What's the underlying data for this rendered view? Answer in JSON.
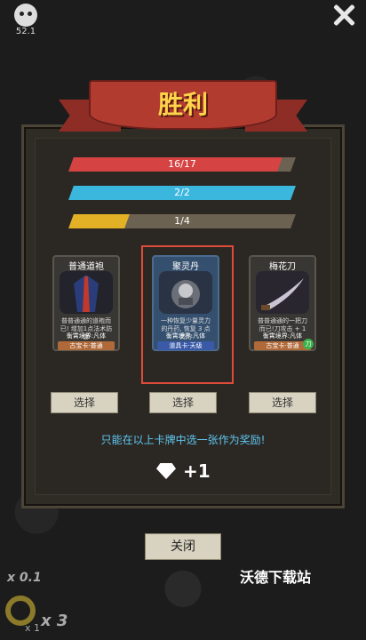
{
  "top": {
    "fps": "52.1"
  },
  "banner": {
    "title": "胜利"
  },
  "bars": [
    {
      "label": "16/17",
      "fill": 0.94,
      "color": "#d64343"
    },
    {
      "label": "2/2",
      "fill": 1.0,
      "color": "#3bb6dd"
    },
    {
      "label": "1/4",
      "fill": 0.25,
      "color": "#e2b126"
    }
  ],
  "cards": [
    {
      "name": "普通道袍",
      "desc": "普普通通的道袍而已! 增加1点法术防御",
      "realm": "衡霄境界:凡体",
      "type": "古宝卡·普通"
    },
    {
      "name": "聚灵丹",
      "desc": "一种恢复少量灵力的丹药, 恢复 3 点灵力",
      "realm": "衡霄境界:凡体",
      "type": "道具卡·天级"
    },
    {
      "name": "梅花刀",
      "desc": "普普通通的一把刀而已!刀攻击 + 1",
      "realm": "衡霄境界:凡体",
      "type": "古宝卡·普通",
      "badge": "刀"
    }
  ],
  "choose_label": "选择",
  "hint": "只能在以上卡牌中选一张作为奖励!",
  "reward": {
    "value": "+1",
    "icon": "diamond-icon"
  },
  "close_label": "关闭",
  "hud": {
    "speed": "x 0.1",
    "count": "x 3",
    "small": "x 1"
  },
  "watermark": "沃德下载站",
  "colors": {
    "accent": "#e04a3b",
    "hint": "#5fc6ef",
    "banner_text": "#ffd44a"
  }
}
